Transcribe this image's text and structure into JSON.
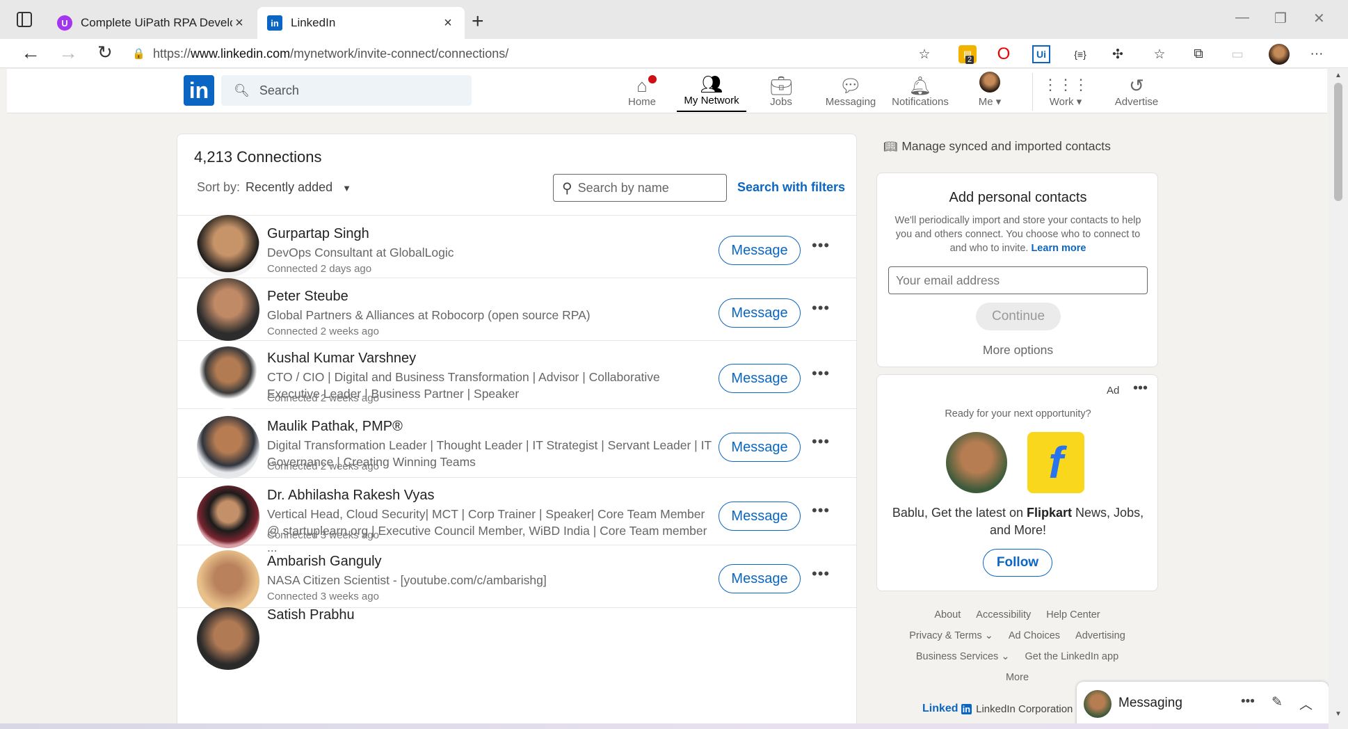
{
  "browser": {
    "tabs": [
      {
        "title": "Complete UiPath RPA Developer",
        "favicon": "udemy-icon",
        "active": false
      },
      {
        "title": "LinkedIn",
        "favicon": "linkedin-icon",
        "active": true
      }
    ],
    "url_prefix": "https://",
    "url_domain": "www.linkedin.com",
    "url_path": "/mynetwork/invite-connect/connections/",
    "extension_badge": "2"
  },
  "header": {
    "logo": "in",
    "search_placeholder": "Search",
    "nav": [
      {
        "label": "Home",
        "icon": "home-icon",
        "badge": true
      },
      {
        "label": "My Network",
        "icon": "network-icon",
        "active": true
      },
      {
        "label": "Jobs",
        "icon": "briefcase-icon"
      },
      {
        "label": "Messaging",
        "icon": "chat-icon"
      },
      {
        "label": "Notifications",
        "icon": "bell-icon"
      },
      {
        "label": "Me",
        "icon": "avatar",
        "dropdown": true
      },
      {
        "label": "Work",
        "icon": "grid-icon",
        "dropdown": true
      },
      {
        "label": "Advertise",
        "icon": "advertise-icon"
      }
    ]
  },
  "connections": {
    "count_label": "4,213 Connections",
    "sort_label": "Sort by:",
    "sort_value": "Recently added",
    "search_placeholder": "Search by name",
    "search_filters": "Search with filters",
    "message_label": "Message",
    "list": [
      {
        "name": "Gurpartap Singh",
        "headline": "DevOps Consultant at GlobalLogic",
        "connected": "Connected 2 days ago"
      },
      {
        "name": "Peter Steube",
        "headline": "Global Partners & Alliances at Robocorp (open source RPA)",
        "connected": "Connected 2 weeks ago"
      },
      {
        "name": "Kushal Kumar Varshney",
        "headline": "CTO / CIO | Digital and Business Transformation | Advisor | Collaborative Executive Leader | Business Partner | Speaker",
        "connected": "Connected 2 weeks ago"
      },
      {
        "name": "Maulik Pathak, PMP®",
        "headline": "Digital Transformation Leader | Thought Leader | IT Strategist | Servant Leader | IT Governance | Creating Winning Teams",
        "connected": "Connected 2 weeks ago"
      },
      {
        "name": "Dr. Abhilasha Rakesh Vyas",
        "headline": "Vertical Head, Cloud Security| MCT | Corp Trainer | Speaker| Core Team Member @ startuplearn.org | Executive Council Member, WiBD India | Core Team member ...",
        "connected": "Connected 3 weeks ago"
      },
      {
        "name": "Ambarish Ganguly",
        "headline": "NASA Citizen Scientist - [youtube.com/c/ambarishg]",
        "connected": "Connected 3 weeks ago"
      },
      {
        "name": "Satish Prabhu",
        "headline": "",
        "connected": ""
      }
    ]
  },
  "sidebar": {
    "manage_link": "Manage synced and imported contacts",
    "add_contacts": {
      "title": "Add personal contacts",
      "description": "We'll periodically import and store your contacts to help you and others connect. You choose who to connect to and who to invite.",
      "learn_more": "Learn more",
      "email_placeholder": "Your email address",
      "continue": "Continue",
      "more_options": "More options"
    },
    "ad": {
      "label": "Ad",
      "question": "Ready for your next opportunity?",
      "text_before": "Bablu, Get the latest on ",
      "brand": "Flipkart",
      "text_after": " News, Jobs, and More!",
      "follow": "Follow"
    },
    "footer": {
      "row1": [
        "About",
        "Accessibility",
        "Help Center"
      ],
      "row2": [
        "Privacy & Terms",
        "Ad Choices",
        "Advertising"
      ],
      "row3": [
        "Business Services",
        "Get the LinkedIn app"
      ],
      "row4": [
        "More"
      ],
      "corp_logo_text": "Linked",
      "corp_logo_box": "in",
      "corp": "LinkedIn Corporation"
    }
  },
  "messaging": {
    "title": "Messaging"
  },
  "colors": {
    "brand": "#0a66c2",
    "background": "#f3f2ef",
    "badge": "#cc1016"
  }
}
